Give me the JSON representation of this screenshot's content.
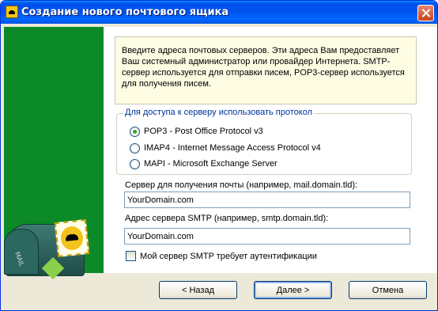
{
  "window": {
    "title": "Создание нового почтового ящика"
  },
  "illustration": {
    "mailbox_label": "MAIL"
  },
  "info_text": "Введите адреса почтовых серверов. Эти адреса Вам предоставляет Ваш системный администратор или провайдер Интернета. SMTP-сервер используется для отправки писем, POP3-сервер используется для получения писем.",
  "protocol_group": {
    "legend": "Для доступа к серверу использовать протокол",
    "options": [
      {
        "label": "POP3 - Post Office Protocol v3",
        "checked": true
      },
      {
        "label": "IMAP4 - Internet Message Access Protocol v4",
        "checked": false
      },
      {
        "label": "MAPI - Microsoft Exchange Server",
        "checked": false
      }
    ]
  },
  "incoming_server": {
    "label": "Сервер для получения почты  (например, mail.domain.tld):",
    "value": "YourDomain.com"
  },
  "smtp_server": {
    "label": "Адрес сервера SMTP (например, smtp.domain.tld):",
    "value": "YourDomain.com"
  },
  "smtp_auth": {
    "label": "Мой сервер SMTP требует аутентификации",
    "checked": false
  },
  "buttons": {
    "back": "< Назад",
    "next": "Далее >",
    "cancel": "Отмена"
  },
  "colors": {
    "titlebar": "#0054e3",
    "side_panel": "#0b8a27",
    "info_background": "#fefce3"
  }
}
